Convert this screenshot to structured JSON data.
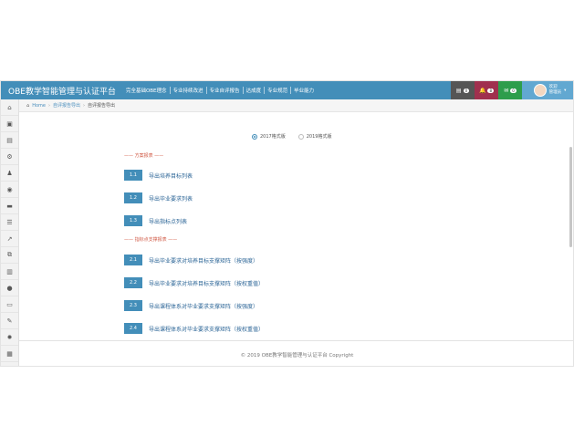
{
  "header": {
    "brand": "OBE教学智能管理与认证平台",
    "nav": [
      "完全基础OBE理念",
      "专业持续改进",
      "专业自评报告",
      "达成度",
      "专业规范",
      "毕业能力"
    ],
    "buttons": [
      {
        "icon": "tasks-icon",
        "glyph": "▤",
        "badge": "0",
        "color": "#555555"
      },
      {
        "icon": "bell-icon",
        "glyph": "🔔",
        "badge": "8",
        "color": "#a0304e"
      },
      {
        "icon": "envelope-icon",
        "glyph": "✉",
        "badge": "0",
        "color": "#2e9d4c"
      }
    ],
    "user": {
      "line1": "欢迎",
      "line2": "管理员",
      "caret": "▾"
    }
  },
  "sidebar": {
    "items": [
      {
        "name": "home",
        "glyph": "⌂"
      },
      {
        "name": "briefcase",
        "glyph": "▣"
      },
      {
        "name": "book",
        "glyph": "▤"
      },
      {
        "name": "gears",
        "glyph": "⚙"
      },
      {
        "name": "user",
        "glyph": "♟"
      },
      {
        "name": "globe",
        "glyph": "◉"
      },
      {
        "name": "folder",
        "glyph": "▬"
      },
      {
        "name": "database",
        "glyph": "☰"
      },
      {
        "name": "line-chart",
        "glyph": "↗"
      },
      {
        "name": "sitemap",
        "glyph": "⧉"
      },
      {
        "name": "bar-chart",
        "glyph": "▥"
      },
      {
        "name": "comment",
        "glyph": "●"
      },
      {
        "name": "desktop",
        "glyph": "▭"
      },
      {
        "name": "edit",
        "glyph": "✎"
      },
      {
        "name": "cog",
        "glyph": "✹"
      },
      {
        "name": "archive",
        "glyph": "▦"
      },
      {
        "name": "collapse",
        "glyph": "«"
      }
    ]
  },
  "breadcrumb": {
    "home": "Home",
    "level1": "自评报告导出",
    "level2": "自评报告导出"
  },
  "radios": [
    {
      "label": "2017格式版",
      "checked": true
    },
    {
      "label": "2019格式版",
      "checked": false
    }
  ],
  "sections": [
    {
      "title": "—— 方案报表 ——",
      "rows": [
        {
          "num": "1.1",
          "label": "导出培养目标列表"
        },
        {
          "num": "1.2",
          "label": "导出毕业要求列表"
        },
        {
          "num": "1.3",
          "label": "导出指标点列表"
        }
      ]
    },
    {
      "title": "—— 指标点支撑报表 ——",
      "rows": [
        {
          "num": "2.1",
          "label": "导出毕业要求对培养目标支撑矩阵（按强度）"
        },
        {
          "num": "2.2",
          "label": "导出毕业要求对培养目标支撑矩阵（按权重值）"
        },
        {
          "num": "2.3",
          "label": "导出课程体系对毕业要求支撑矩阵（按强度）"
        },
        {
          "num": "2.4",
          "label": "导出课程体系对毕业要求支撑矩阵（按权重值）"
        }
      ]
    }
  ],
  "footer": "© 2019 OBE教学智能管理与认证平台 Copyright"
}
